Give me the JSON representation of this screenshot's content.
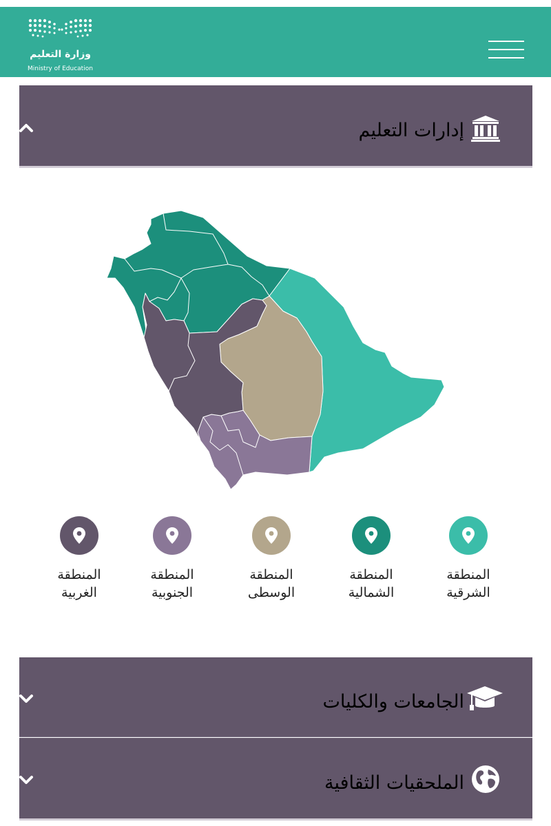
{
  "header": {
    "logo_ar": "وزارة التعليم",
    "logo_en": "Ministry of Education",
    "color": "#33ad98"
  },
  "sections": [
    {
      "title": "إدارات التعليم",
      "icon": "institution-building-icon",
      "expanded": true
    },
    {
      "title": "الجامعات والكليات",
      "icon": "graduation-cap-icon",
      "expanded": false
    },
    {
      "title": "الملحقيات الثقافية",
      "icon": "globe-icon",
      "expanded": false
    }
  ],
  "regions": [
    {
      "label": "المنطقة\nالشرقية",
      "color": "#3bbda9"
    },
    {
      "label": "المنطقة\nالشمالية",
      "color": "#1c8f7c"
    },
    {
      "label": "المنطقة\nالوسطى",
      "color": "#b3a68c"
    },
    {
      "label": "المنطقة\nالجنوبية",
      "color": "#8a7797"
    },
    {
      "label": "المنطقة\nالغربية",
      "color": "#62566a"
    }
  ],
  "colors": {
    "section_bg": "#62566a",
    "section_text": "#ffffff"
  }
}
